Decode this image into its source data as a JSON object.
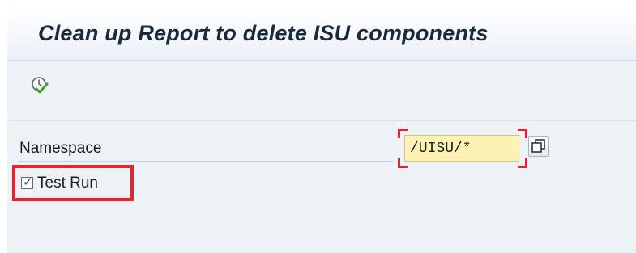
{
  "window": {
    "title": "Clean up Report to delete ISU components"
  },
  "toolbar": {
    "execute_icon": "execute-check-icon"
  },
  "selection_screen": {
    "namespace": {
      "label": "Namespace",
      "value": "/UISU/*"
    },
    "multiple_selection_icon": "multiple-selection-icon",
    "test_run": {
      "label": "Test Run",
      "checked": true
    }
  },
  "colors": {
    "highlight": "#e8232d",
    "field_background": "#fbf2b3",
    "panel_background": "#edf2f7"
  }
}
